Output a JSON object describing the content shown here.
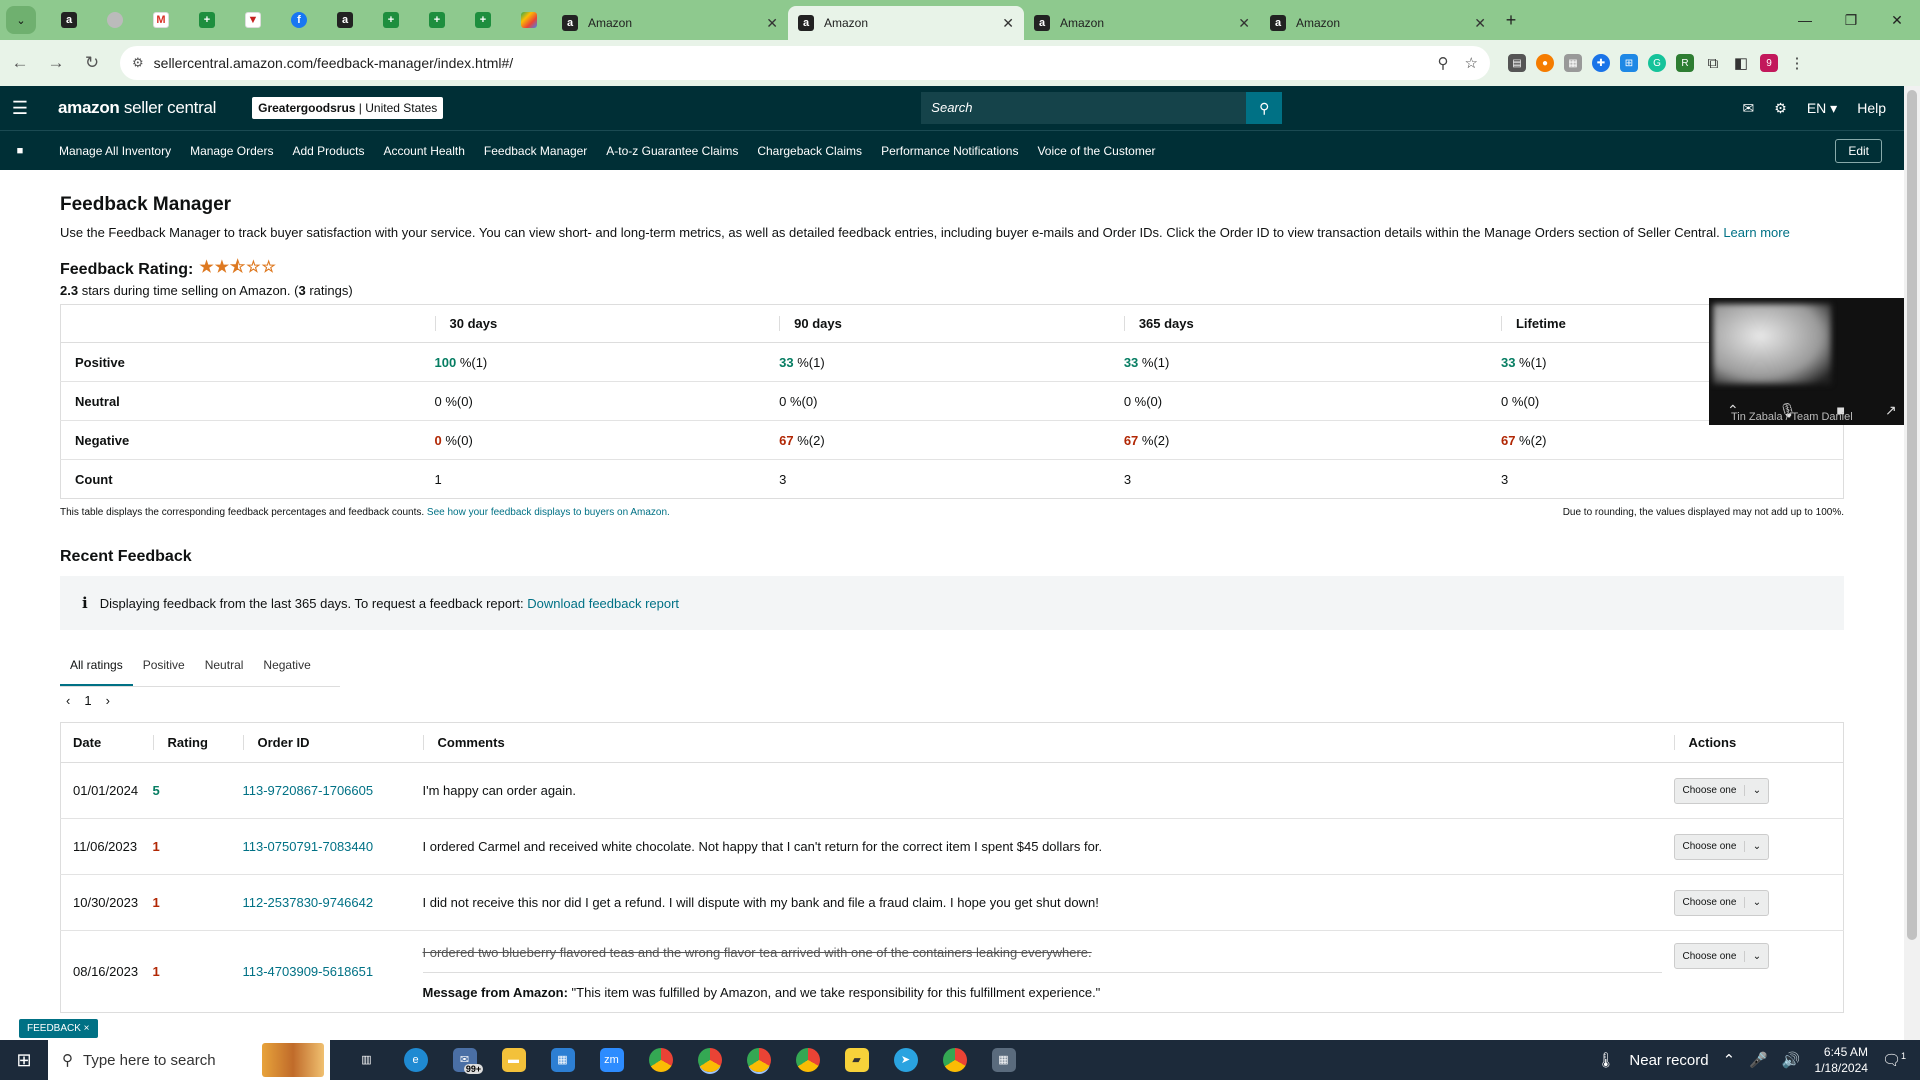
{
  "browser": {
    "tabs": [
      {
        "title": "Amazon",
        "active": false
      },
      {
        "title": "Amazon",
        "active": true
      },
      {
        "title": "Amazon",
        "active": false
      },
      {
        "title": "Amazon",
        "active": false
      }
    ],
    "url": "sellercentral.amazon.com/feedback-manager/index.html#/",
    "profile_initial": "9"
  },
  "header": {
    "logo_main": "amazon",
    "logo_sub": " seller central",
    "account_name": "Greatergoodsrus",
    "account_region": " | United States",
    "search_placeholder": "Search",
    "language": "EN",
    "help": "Help"
  },
  "nav": {
    "items": [
      "Manage All Inventory",
      "Manage Orders",
      "Add Products",
      "Account Health",
      "Feedback Manager",
      "A-to-z Guarantee Claims",
      "Chargeback Claims",
      "Performance Notifications",
      "Voice of the Customer"
    ],
    "edit": "Edit"
  },
  "page": {
    "title": "Feedback Manager",
    "description": "Use the Feedback Manager to track buyer satisfaction with your service. You can view short- and long-term metrics, as well as detailed feedback entries, including buyer e-mails and Order IDs. Click the Order ID to view transaction details within the Manage Orders section of Seller Central. ",
    "learn_more": "Learn more",
    "rating_label": "Feedback Rating:",
    "stars_value": 2.3,
    "stars_display": "★★⯪☆☆",
    "rating_value": "2.3",
    "rating_text_1": " stars during time selling on Amazon. (",
    "rating_count": "3",
    "rating_text_2": " ratings)"
  },
  "summary_table": {
    "headers": [
      "30 days",
      "90 days",
      "365 days",
      "Lifetime"
    ],
    "rows": [
      {
        "label": "Positive",
        "cells": [
          {
            "pct": "100",
            "rest": " %(1)"
          },
          {
            "pct": "33",
            "rest": " %(1)"
          },
          {
            "pct": "33",
            "rest": " %(1)"
          },
          {
            "pct": "33",
            "rest": " %(1)"
          }
        ]
      },
      {
        "label": "Neutral",
        "cells": [
          {
            "pct": "0",
            "rest": " %(0)"
          },
          {
            "pct": "0",
            "rest": " %(0)"
          },
          {
            "pct": "0",
            "rest": " %(0)"
          },
          {
            "pct": "0",
            "rest": " %(0)"
          }
        ]
      },
      {
        "label": "Negative",
        "cells": [
          {
            "pct": "0",
            "rest": " %(0)"
          },
          {
            "pct": "67",
            "rest": " %(2)"
          },
          {
            "pct": "67",
            "rest": " %(2)"
          },
          {
            "pct": "67",
            "rest": " %(2)"
          }
        ]
      },
      {
        "label": "Count",
        "cells": [
          {
            "pct": "",
            "rest": "1"
          },
          {
            "pct": "",
            "rest": "3"
          },
          {
            "pct": "",
            "rest": "3"
          },
          {
            "pct": "",
            "rest": "3"
          }
        ]
      }
    ],
    "note_left": "This table displays the corresponding feedback percentages and feedback counts. ",
    "note_link": "See how your feedback displays to buyers on Amazon.",
    "note_right": "Due to rounding, the values displayed may not add up to 100%."
  },
  "recent": {
    "title": "Recent Feedback",
    "info_text": "Displaying feedback from the last 365 days. To request a feedback report: ",
    "info_link": "Download feedback report",
    "tabs": [
      "All ratings",
      "Positive",
      "Neutral",
      "Negative"
    ],
    "page": "1",
    "columns": [
      "Date",
      "Rating",
      "Order ID",
      "Comments",
      "Actions"
    ],
    "rows": [
      {
        "date": "01/01/2024",
        "rating": "5",
        "order_id": "113-9720867-1706605",
        "comment": "I'm happy can order again.",
        "action": "Choose one"
      },
      {
        "date": "11/06/2023",
        "rating": "1",
        "order_id": "113-0750791-7083440",
        "comment": "I ordered Carmel and received white chocolate. Not happy that I can't return for the correct item I spent $45 dollars for.",
        "action": "Choose one"
      },
      {
        "date": "10/30/2023",
        "rating": "1",
        "order_id": "112-2537830-9746642",
        "comment": "I did not receive this nor did I get a refund. I will dispute with my bank and file a fraud claim. I hope you get shut down!",
        "action": "Choose one"
      },
      {
        "date": "08/16/2023",
        "rating": "1",
        "order_id": "113-4703909-5618651",
        "comment": "I ordered two blueberry flavored teas and the wrong flavor tea arrived with one of the containers leaking everywhere.",
        "action": "Choose one",
        "message_label": "Message from Amazon:",
        "message": " \"This item was fulfilled by Amazon, and we take responsibility for this fulfillment experience.\""
      }
    ]
  },
  "video": {
    "name": "Tin Zabala / Team Daniel"
  },
  "feedback_pill": "FEEDBACK ×",
  "taskbar": {
    "search_placeholder": "Type here to search",
    "weather": "Near record",
    "time": "6:45 AM",
    "date": "1/18/2024",
    "badge": "99+",
    "notif": "1"
  },
  "colors": {
    "header_bg": "#002f36",
    "link": "#007185",
    "positive": "#067d62",
    "negative": "#b12704",
    "tab_bar": "#8ec98e"
  }
}
